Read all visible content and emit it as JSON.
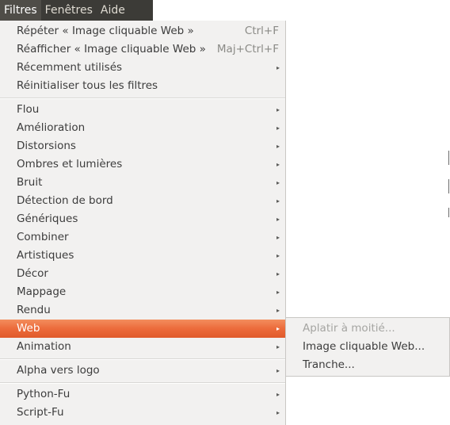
{
  "menubar": {
    "items": [
      {
        "label": "Filtres"
      },
      {
        "label": "Fenêtres"
      },
      {
        "label": "Aide"
      }
    ]
  },
  "menu": {
    "items": [
      {
        "label": "Répéter « Image cliquable Web »",
        "accel": "Ctrl+F"
      },
      {
        "label": "Réafficher « Image cliquable Web »",
        "accel": "Maj+Ctrl+F"
      },
      {
        "label": "Récemment utilisés"
      },
      {
        "label": "Réinitialiser tous les filtres"
      },
      {
        "label": "Flou"
      },
      {
        "label": "Amélioration"
      },
      {
        "label": "Distorsions"
      },
      {
        "label": "Ombres et lumières"
      },
      {
        "label": "Bruit"
      },
      {
        "label": "Détection de bord"
      },
      {
        "label": "Génériques"
      },
      {
        "label": "Combiner"
      },
      {
        "label": "Artistiques"
      },
      {
        "label": "Décor"
      },
      {
        "label": "Mappage"
      },
      {
        "label": "Rendu"
      },
      {
        "label": "Web"
      },
      {
        "label": "Animation"
      },
      {
        "label": "Alpha vers logo"
      },
      {
        "label": "Python-Fu"
      },
      {
        "label": "Script-Fu"
      }
    ]
  },
  "submenu": {
    "items": [
      {
        "label": "Aplatir à moitié...",
        "enabled": false
      },
      {
        "label": "Image cliquable Web...",
        "enabled": true
      },
      {
        "label": "Tranche...",
        "enabled": true
      }
    ]
  },
  "colors": {
    "highlight": "#ec6b3b",
    "menubar_bg": "#3c3b37",
    "menu_bg": "#f2f1f0"
  }
}
